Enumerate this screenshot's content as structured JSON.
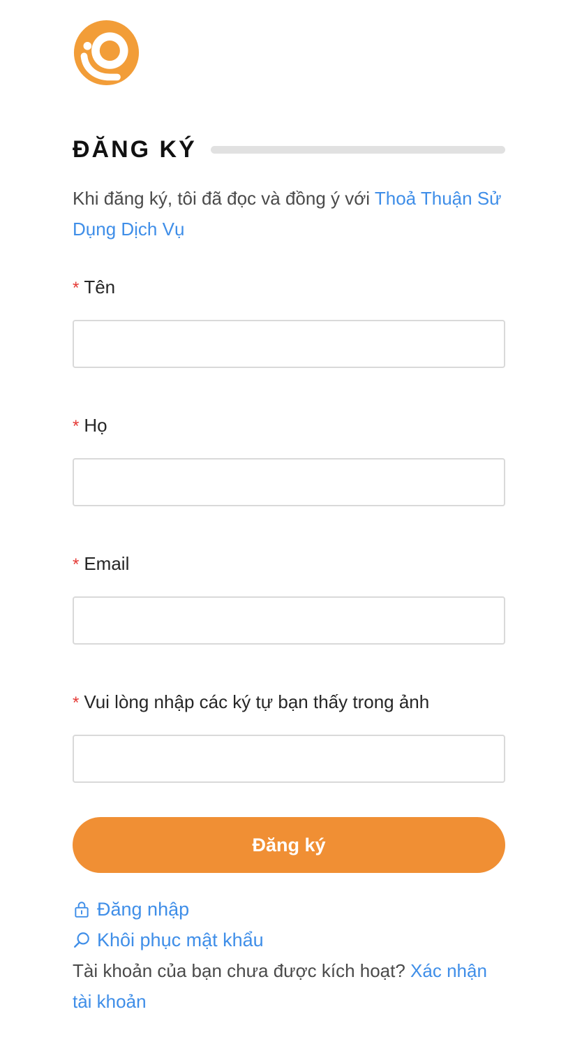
{
  "logo": {
    "icon": "brand-logo-icon",
    "color": "#f29d38"
  },
  "heading": "ĐĂNG KÝ",
  "intro": {
    "text": "Khi đăng ký, tôi đã đọc và đồng ý với",
    "link": "Thoả Thuận Sử Dụng Dịch Vụ"
  },
  "form": {
    "first_name_label": "Tên",
    "last_name_label": "Họ",
    "email_label": "Email",
    "captcha_label": "Vui lòng nhập các ký tự bạn thấy trong ảnh",
    "required_mark": "*",
    "first_name_value": "",
    "last_name_value": "",
    "email_value": "",
    "captcha_value": ""
  },
  "submit_label": "Đăng ký",
  "footer": {
    "login_label": "Đăng nhập",
    "login_icon": "lock-icon",
    "recover_label": "Khôi phục mật khẩu",
    "recover_icon": "search-icon",
    "activate_text": "Tài khoản của bạn chưa được kích hoạt?",
    "activate_link": "Xác nhận tài khoản"
  },
  "colors": {
    "accent": "#f08f34",
    "link": "#3f8ee8",
    "required": "#e53935"
  }
}
